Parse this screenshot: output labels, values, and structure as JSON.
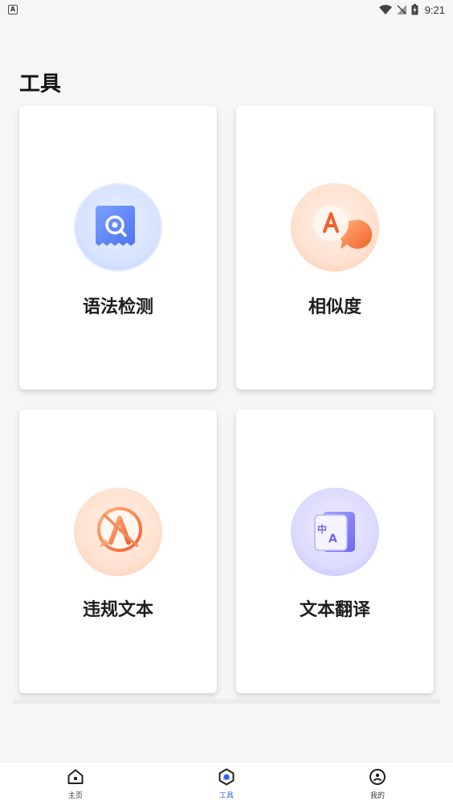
{
  "status_bar": {
    "time": "9:21",
    "app_icon_letter": "A"
  },
  "page": {
    "title": "工具"
  },
  "tools": [
    {
      "label": "语法检测",
      "icon": "magnifier-document-icon",
      "accent": "#5b84f5"
    },
    {
      "label": "相似度",
      "icon": "chat-letter-a-icon",
      "accent": "#f27a45"
    },
    {
      "label": "违规文本",
      "icon": "prohibited-letter-a-icon",
      "accent": "#f27a45"
    },
    {
      "label": "文本翻译",
      "icon": "translate-icon",
      "accent": "#7a76f0"
    }
  ],
  "tab_bar": {
    "tabs": [
      {
        "label": "主页",
        "icon": "home-icon",
        "active": false
      },
      {
        "label": "工具",
        "icon": "tools-icon",
        "active": true
      },
      {
        "label": "我的",
        "icon": "profile-icon",
        "active": false
      }
    ],
    "active_color": "#3b63f2"
  }
}
